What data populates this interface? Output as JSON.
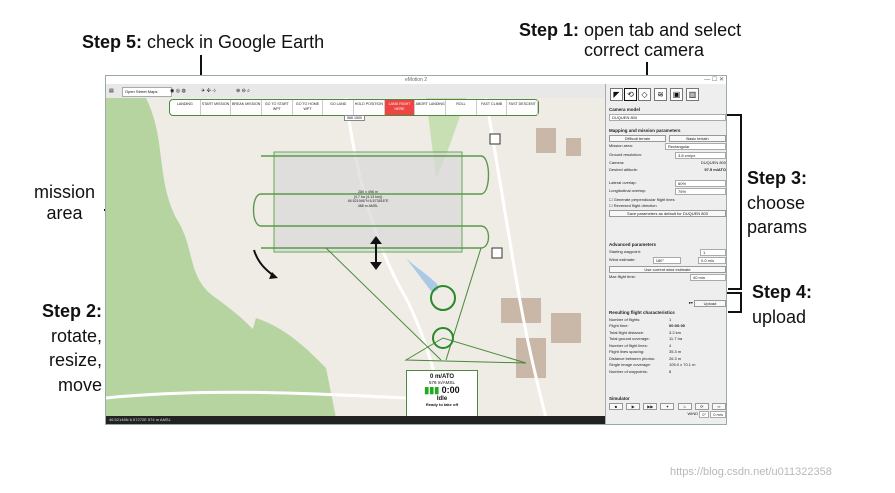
{
  "annotations": {
    "step5_bold": "Step 5:",
    "step5_text": " check in Google Earth",
    "step1_bold": "Step 1:",
    "step1_text": " open tab and select",
    "step1_line2": "correct camera",
    "mission_line1": "mission",
    "mission_line2": "area",
    "step3_bold": "Step 3:",
    "step3_line2": "choose",
    "step3_line3": "params",
    "step4_bold": "Step 4:",
    "step4_line2": "upload",
    "step2_bold": "Step 2:",
    "step2_line2": "rotate,",
    "step2_line3": "resize,",
    "step2_line4": "move",
    "watermark": "https://blog.csdn.net/u011322358"
  },
  "window": {
    "title": "eMotion 2",
    "map_source": "Open Street Maps"
  },
  "modes": [
    "LANDING",
    "START MISSION",
    "BREAK MISSION",
    "GO TO START WPT",
    "GO TO HOME WPT",
    "GO LAND",
    "HOLD POSITION",
    "LAND RIGHT HERE",
    "ABORT LANDING",
    "ROLL",
    "FAST CLIMB",
    "FAST DESCENT"
  ],
  "map": {
    "area_info_1": "280 x 496 m",
    "area_info_2": "(4.7 ha (4.13 km))",
    "area_info_3": "46.521946°N 6.573816°E",
    "area_info_4": "466 m AMSL",
    "altitude_marker": "966 1500",
    "status": {
      "speed": "0 m/ATO",
      "altitude": "578 m/AMSL",
      "time": "0:00",
      "state": "Idle",
      "ready": "Ready to take off"
    },
    "coords": "46.52146N 6.57272E 574 m AMSL"
  },
  "panel": {
    "camera_header": "Camera model",
    "camera_value": "DUQUEN 800",
    "mapping_header": "Mapping and mission parameters",
    "btn_left": "Difficult terrain",
    "btn_right": "Basic terrain",
    "rows": [
      {
        "label": "Mission area:",
        "value": "Rectangular"
      },
      {
        "label": "Ground resolution:",
        "value": "3.8 cm/px"
      },
      {
        "label": "Camera:",
        "value": "DUQUEN 800"
      },
      {
        "label": "Desired altitude:",
        "value": "97.5 m/ATO"
      }
    ],
    "lateral_label": "Lateral overlap:",
    "lateral_value": "60%",
    "long_label": "Longitudinal overlap:",
    "long_value": "75%",
    "gen_perp": "Generate perpendicular flight lines",
    "reverse": "Reversed flight direction",
    "save_params": "Save parameters as default for DUQUEN 800",
    "advanced_header": "Advanced parameters",
    "starting_wp": "Starting waypoint:",
    "wind_label": "Wind estimate:",
    "wind_dir": "180°",
    "wind_speed": "0.0 m/s",
    "current_wind": "Use current wind estimate",
    "max_time": "Max flight time:",
    "max_time_value": "40 min",
    "upload": "Upload",
    "results_header": "Resulting flight characteristics",
    "results": [
      {
        "label": "Number of flights:",
        "value": "1"
      },
      {
        "label": "Flight time:",
        "value": "00:00:00"
      },
      {
        "label": "Total flight distance:",
        "value": "3.2 km"
      },
      {
        "label": "Total ground coverage:",
        "value": "11.7 ha"
      },
      {
        "label": "Number of flight lines:",
        "value": "4"
      },
      {
        "label": "Flight lines spacing:",
        "value": "35.3 m"
      },
      {
        "label": "Distance between photos:",
        "value": "26.3 m"
      },
      {
        "label": "Single image coverage:",
        "value": "105.0 x 70.1 m"
      },
      {
        "label": "Number of waypoints:",
        "value": "8"
      }
    ],
    "simulator": "Simulator",
    "sim_wind": "WIND",
    "sim_dir": "0°",
    "sim_speed": "0 m/s"
  }
}
